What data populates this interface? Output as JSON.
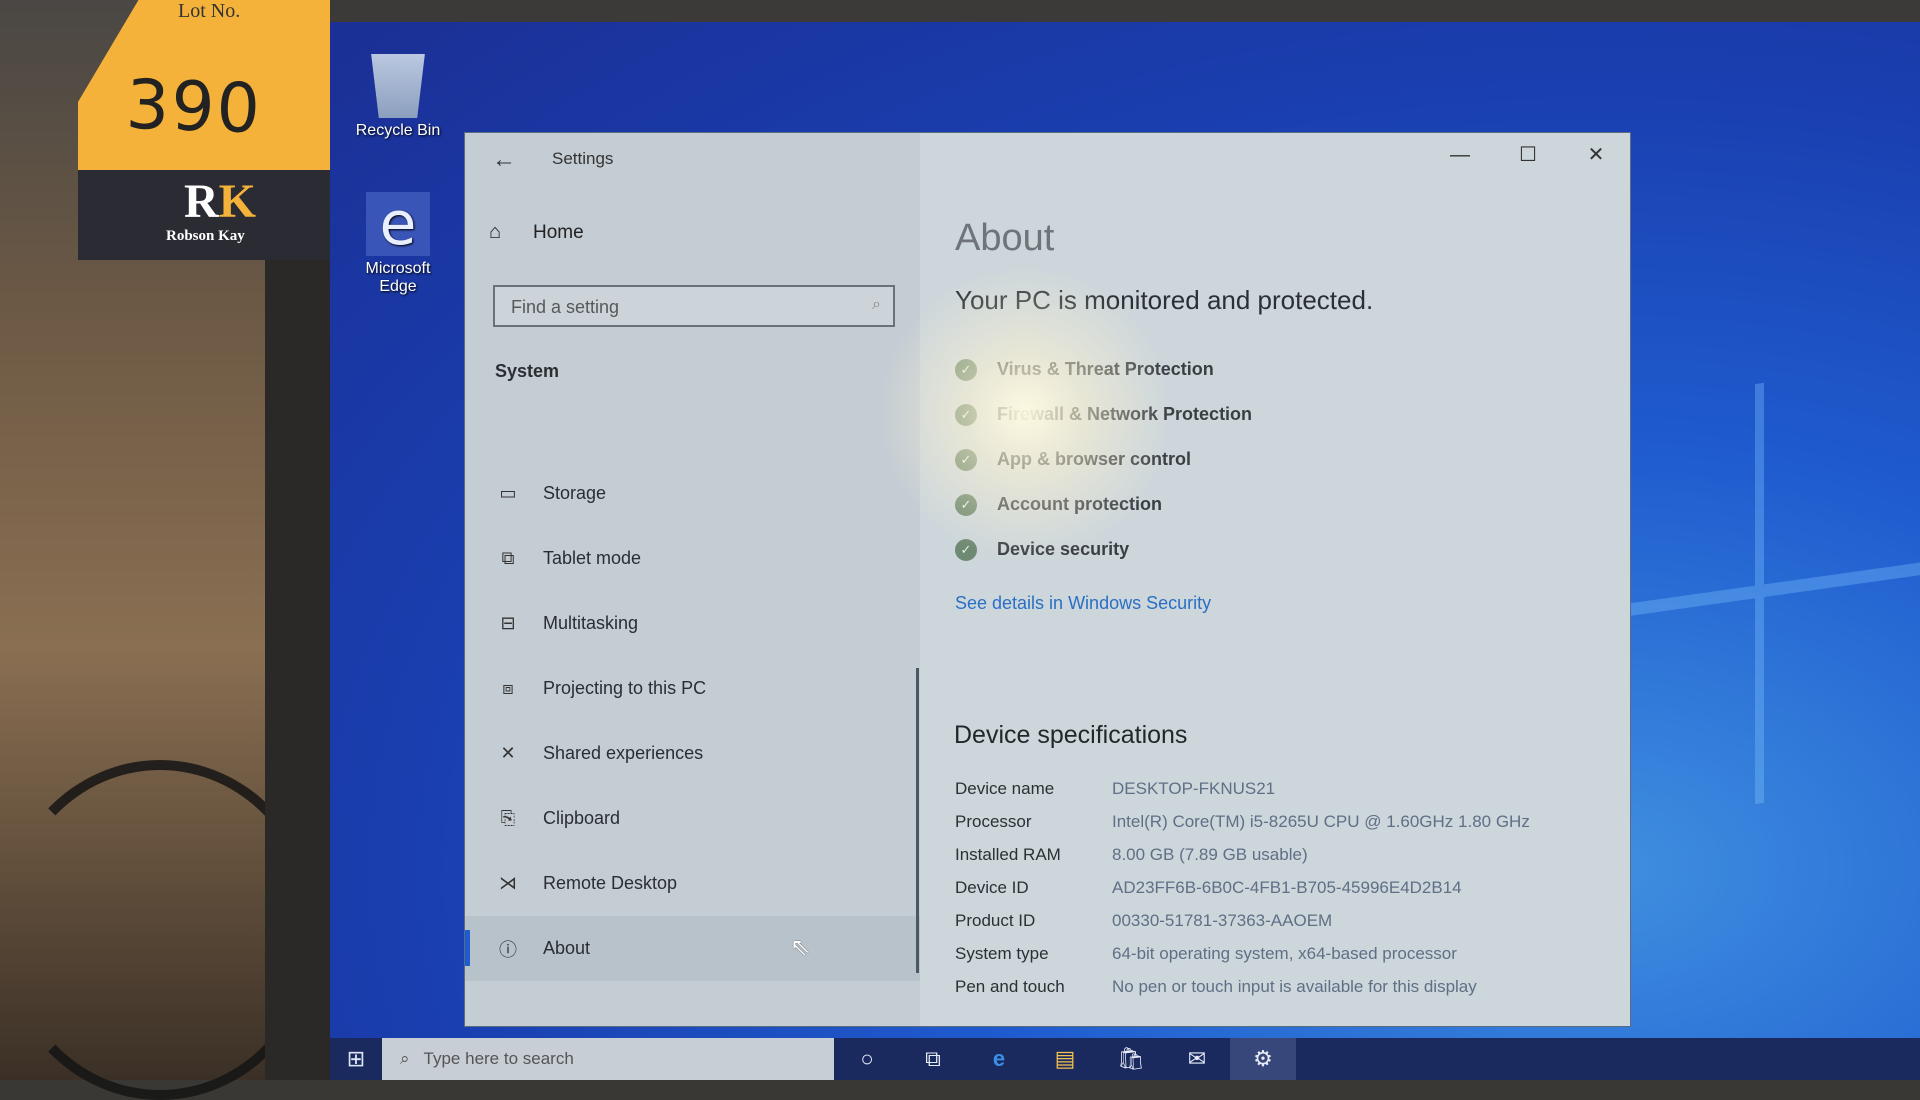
{
  "photo": {
    "lot_label": {
      "title": "Lot No.",
      "number": "390"
    },
    "brand_logo": {
      "monogram_r": "R",
      "monogram_k": "K",
      "name": "Robson Kay"
    }
  },
  "desktop": {
    "icons": [
      {
        "label": "Recycle Bin",
        "icon": "recycle-bin-icon"
      },
      {
        "label": "Microsoft Edge",
        "icon": "edge-icon"
      }
    ]
  },
  "window": {
    "title": "Settings",
    "controls": {
      "minimize": "—",
      "maximize": "☐",
      "close": "✕"
    }
  },
  "nav": {
    "home_label": "Home",
    "search_placeholder": "Find a setting",
    "section_title": "System",
    "items": [
      {
        "label": "Storage",
        "icon": "storage-icon",
        "glyph": "▭"
      },
      {
        "label": "Tablet mode",
        "icon": "tablet-mode-icon",
        "glyph": "⧉"
      },
      {
        "label": "Multitasking",
        "icon": "multitasking-icon",
        "glyph": "⊟"
      },
      {
        "label": "Projecting to this PC",
        "icon": "projecting-icon",
        "glyph": "⧈"
      },
      {
        "label": "Shared experiences",
        "icon": "shared-experiences-icon",
        "glyph": "✕"
      },
      {
        "label": "Clipboard",
        "icon": "clipboard-icon",
        "glyph": "📋"
      },
      {
        "label": "Remote Desktop",
        "icon": "remote-desktop-icon",
        "glyph": "⋊"
      },
      {
        "label": "About",
        "icon": "info-icon",
        "glyph": "ⓘ",
        "active": true
      }
    ]
  },
  "about": {
    "title": "About",
    "protection_message": "Your PC is monitored and protected.",
    "security_items": [
      "Virus & Threat Protection",
      "Firewall & Network Protection",
      "App & browser control",
      "Account protection",
      "Device security"
    ],
    "security_link": "See details in Windows Security",
    "specs_title": "Device specifications",
    "specs": [
      {
        "key": "Device name",
        "value": "DESKTOP-FKNUS21"
      },
      {
        "key": "Processor",
        "value": "Intel(R) Core(TM) i5-8265U CPU @ 1.60GHz   1.80 GHz"
      },
      {
        "key": "Installed RAM",
        "value": "8.00 GB (7.89 GB usable)"
      },
      {
        "key": "Device ID",
        "value": "AD23FF6B-6B0C-4FB1-B705-45996E4D2B14"
      },
      {
        "key": "Product ID",
        "value": "00330-51781-37363-AAOEM"
      },
      {
        "key": "System type",
        "value": "64-bit operating system, x64-based processor"
      },
      {
        "key": "Pen and touch",
        "value": "No pen or touch input is available for this display"
      }
    ]
  },
  "taskbar": {
    "search_placeholder": "Type here to search",
    "apps": [
      {
        "name": "cortana-icon",
        "glyph": "○"
      },
      {
        "name": "task-view-icon",
        "glyph": "⧉"
      },
      {
        "name": "edge-taskbar-icon",
        "glyph": "e"
      },
      {
        "name": "file-explorer-icon",
        "glyph": "▤"
      },
      {
        "name": "store-icon",
        "glyph": "🛍"
      },
      {
        "name": "mail-icon",
        "glyph": "✉"
      },
      {
        "name": "settings-taskbar-icon",
        "glyph": "⚙",
        "active": true
      }
    ]
  },
  "colors": {
    "accent": "#1f5ccf",
    "link": "#2a6fc4",
    "taskbar": "#1b2a5e",
    "shield_ok": "#6f8a72"
  }
}
